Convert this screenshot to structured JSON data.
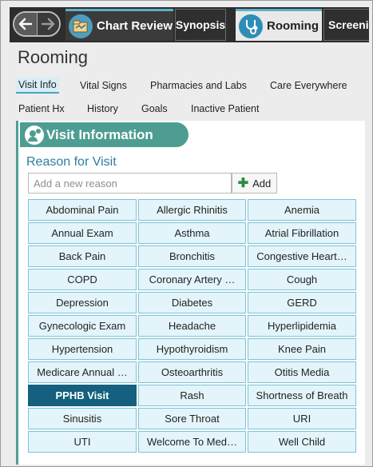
{
  "tabs": {
    "chart_review": "Chart Review",
    "synopsis": "Synopsis",
    "rooming": "Rooming",
    "screening": "Screenin"
  },
  "page": {
    "title": "Rooming"
  },
  "subnav": {
    "row1": [
      "Visit Info",
      "Vital Signs",
      "Pharmacies and Labs",
      "Care Everywhere"
    ],
    "row2": [
      "Patient Hx",
      "History",
      "Goals",
      "Inactive Patient"
    ]
  },
  "visit_info": {
    "header": "Visit Information",
    "section_title": "Reason for Visit",
    "input_placeholder": "Add a new reason",
    "add_label": "Add",
    "reasons": [
      "Abdominal Pain",
      "Allergic Rhinitis",
      "Anemia",
      "Annual Exam",
      "Asthma",
      "Atrial Fibrillation",
      "Back Pain",
      "Bronchitis",
      "Congestive Heart…",
      "COPD",
      "Coronary Artery …",
      "Cough",
      "Depression",
      "Diabetes",
      "GERD",
      "Gynecologic Exam",
      "Headache",
      "Hyperlipidemia",
      "Hypertension",
      "Hypothyroidism",
      "Knee Pain",
      "Medicare Annual …",
      "Osteoarthritis",
      "Otitis Media",
      "PPHB Visit",
      "Rash",
      "Shortness of Breath",
      "Sinusitis",
      "Sore Throat",
      "URI",
      "UTI",
      "Welcome To Med…",
      "Well Child"
    ],
    "selected_reason": "PPHB Visit"
  },
  "colors": {
    "accent_teal": "#4e9d92",
    "selected_chip": "#14607e",
    "chip_bg": "#e3f5fa",
    "tab_highlight": "#5db0c9"
  },
  "icons": {
    "back": "arrow-left-icon",
    "forward": "arrow-right-icon",
    "chart_review": "chart-folder-icon",
    "rooming": "stethoscope-icon",
    "visit_info": "person-chat-icon",
    "add": "plus-icon"
  }
}
